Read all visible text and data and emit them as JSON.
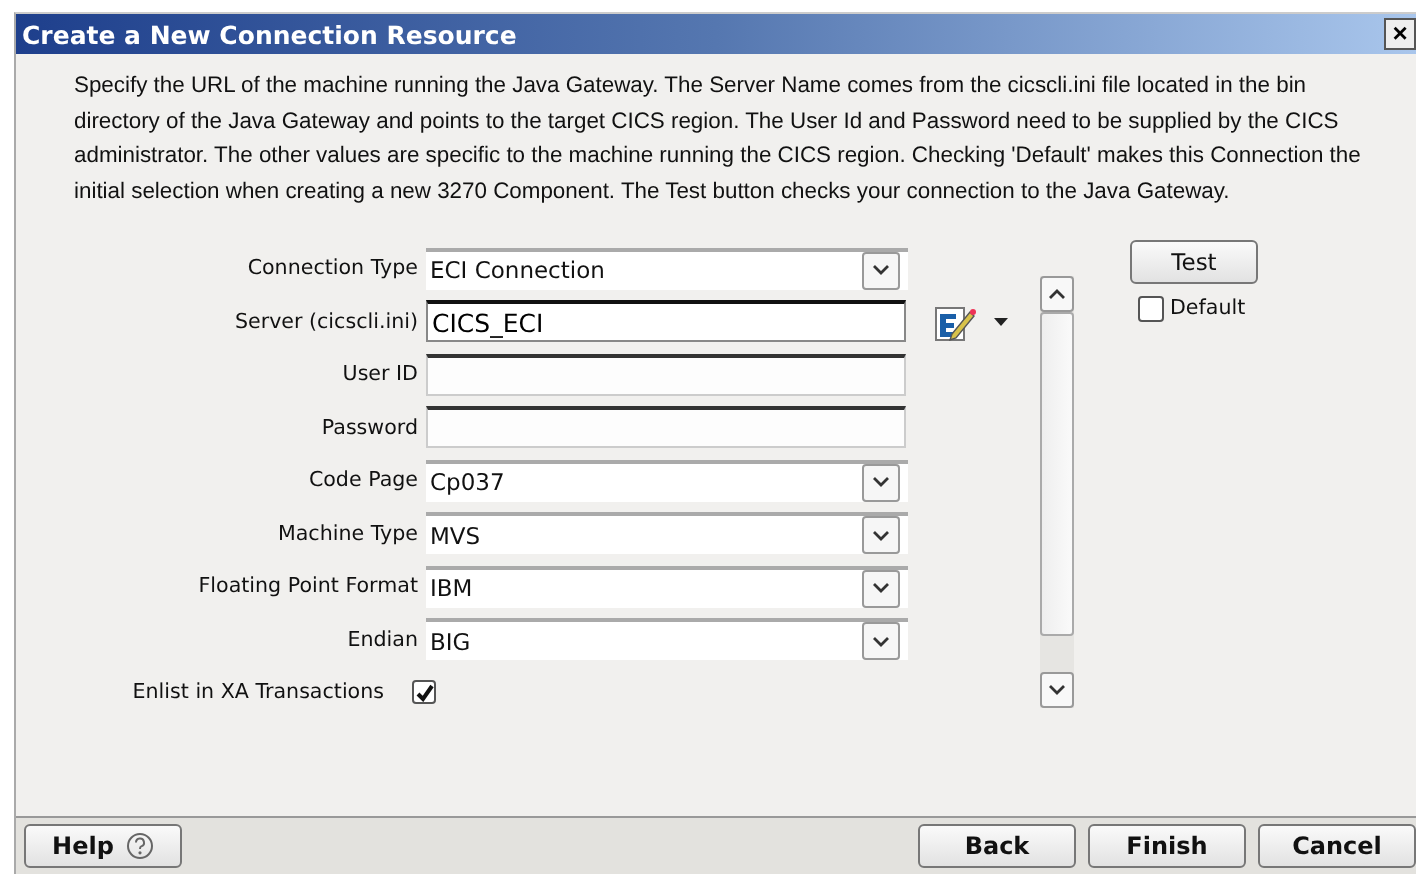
{
  "window": {
    "title": "Create a New Connection Resource",
    "close": "×"
  },
  "description": "Specify the URL of the machine running the Java Gateway. The Server Name comes from the cicscli.ini file located in the bin directory of the Java Gateway and points to the target CICS region. The User Id and Password need to be supplied by the CICS administrator. The other values are specific to the machine running the CICS region. Checking 'Default' makes this Connection the initial selection when creating a new 3270 Component. The Test button checks your connection to the Java Gateway.",
  "fields": [
    {
      "label": "Connection Type",
      "kind": "combo",
      "value": "ECI Connection"
    },
    {
      "label": "Server (cicscli.ini)",
      "kind": "text",
      "value": "CICS_ECI",
      "focused": true
    },
    {
      "label": "User ID",
      "kind": "text",
      "focused": false
    },
    {
      "label": "Password",
      "kind": "text",
      "focused": false
    },
    {
      "label": "Code Page",
      "kind": "combo",
      "value": "Cp037"
    },
    {
      "label": "Machine Type",
      "kind": "combo",
      "value": "MVS"
    },
    {
      "label": "Floating Point Format",
      "kind": "combo",
      "value": "IBM"
    },
    {
      "label": "Endian",
      "kind": "combo",
      "value": "BIG"
    },
    {
      "label": "Enlist in XA Transactions",
      "kind": "checkbox",
      "checked": true
    }
  ],
  "test_button": "Test",
  "default_checkbox": {
    "label": "Default",
    "checked": false
  },
  "buttons": {
    "help": "Help",
    "back": "Back",
    "finish": "Finish",
    "cancel": "Cancel"
  }
}
